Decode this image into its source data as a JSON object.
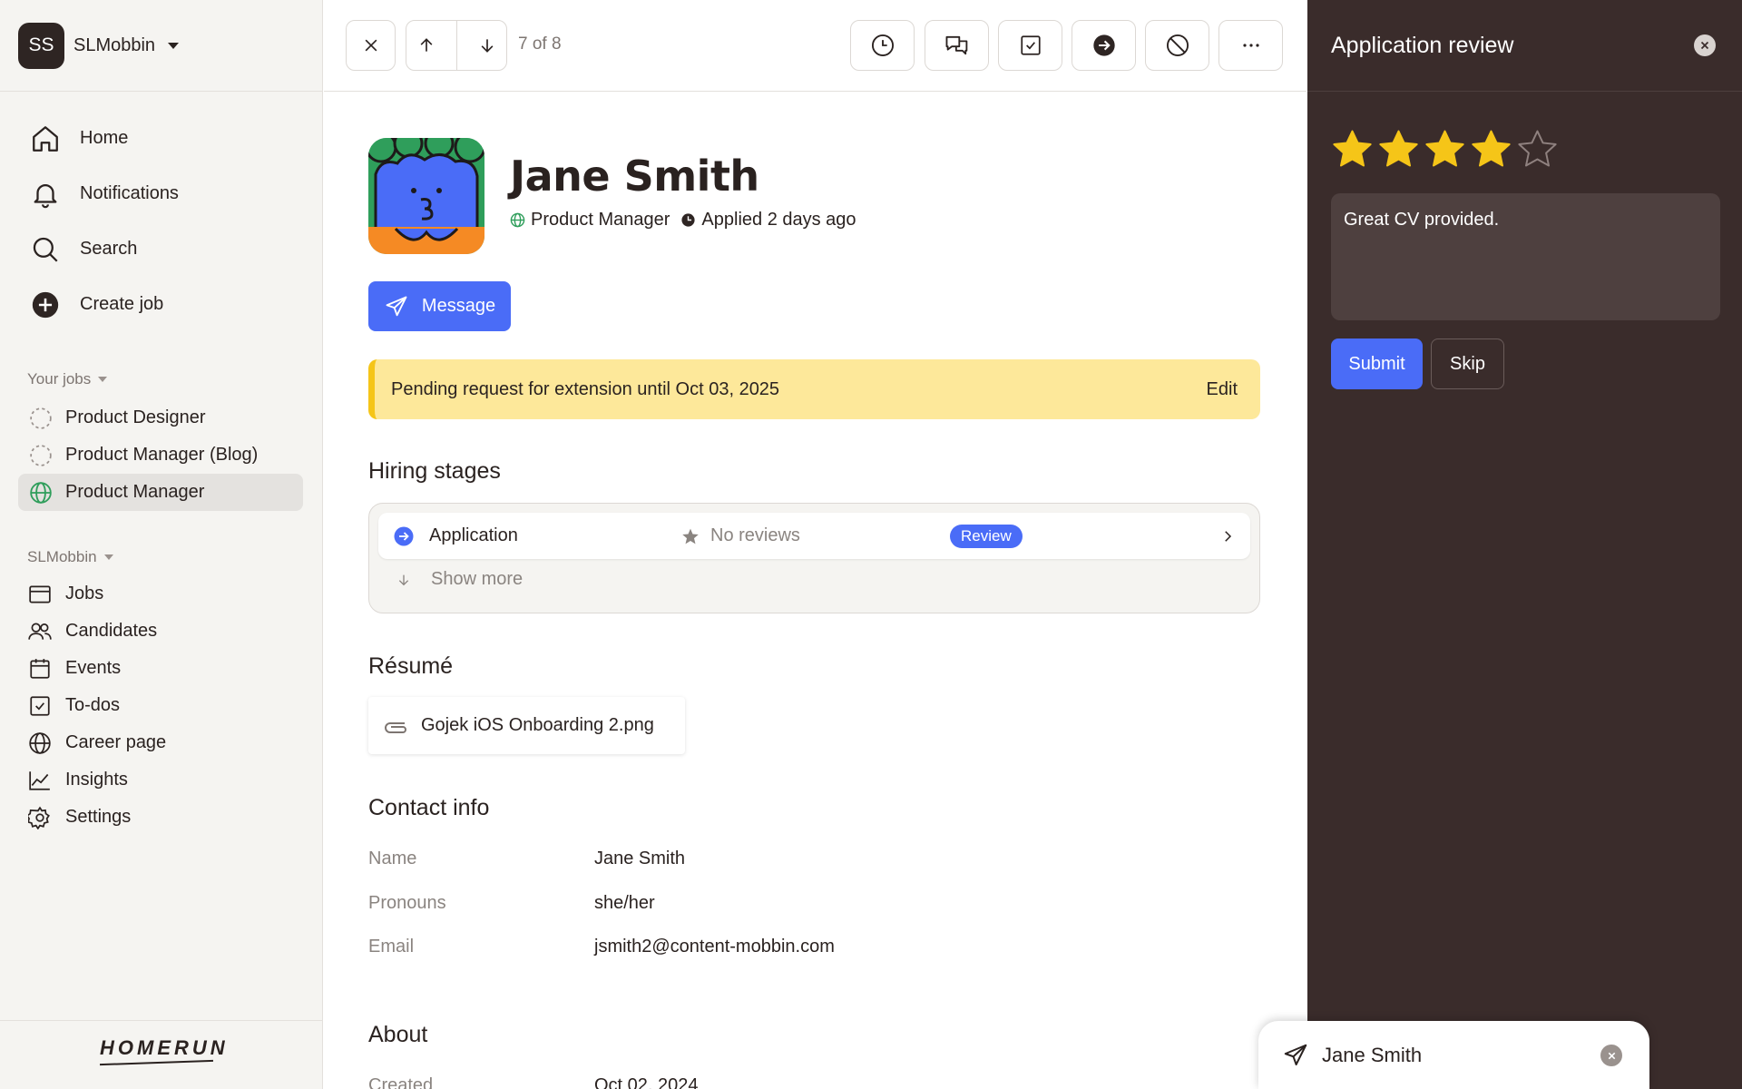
{
  "workspace": {
    "initials": "SS",
    "name": "SLMobbin"
  },
  "nav": [
    {
      "label": "Home",
      "icon": "home-icon"
    },
    {
      "label": "Notifications",
      "icon": "bell-icon"
    },
    {
      "label": "Search",
      "icon": "search-icon"
    },
    {
      "label": "Create job",
      "icon": "plus-circle-icon"
    }
  ],
  "your_jobs": {
    "heading": "Your jobs",
    "items": [
      {
        "label": "Product Designer",
        "icon": "draft-circle-icon"
      },
      {
        "label": "Product Manager (Blog)",
        "icon": "draft-circle-icon"
      },
      {
        "label": "Product Manager",
        "icon": "globe-icon",
        "active": true
      }
    ]
  },
  "org": {
    "heading": "SLMobbin",
    "items": [
      {
        "label": "Jobs",
        "icon": "window-icon"
      },
      {
        "label": "Candidates",
        "icon": "users-icon"
      },
      {
        "label": "Events",
        "icon": "calendar-icon"
      },
      {
        "label": "To-dos",
        "icon": "checkbox-icon"
      },
      {
        "label": "Career page",
        "icon": "globe-icon"
      },
      {
        "label": "Insights",
        "icon": "chart-icon"
      },
      {
        "label": "Settings",
        "icon": "gear-icon"
      }
    ]
  },
  "brand": {
    "logo_text": "HOMERUN"
  },
  "toolbar": {
    "counter": "7 of 8"
  },
  "candidate": {
    "name": "Jane Smith",
    "role": "Product Manager",
    "applied": "Applied 2 days ago",
    "message_label": "Message"
  },
  "banner": {
    "text": "Pending request for extension until Oct 03, 2025",
    "action": "Edit"
  },
  "hiring": {
    "title": "Hiring stages",
    "stage": "Application",
    "reviews": "No reviews",
    "badge": "Review",
    "show_more": "Show more"
  },
  "resume": {
    "title": "Résumé",
    "file": "Gojek iOS Onboarding 2.png"
  },
  "contact": {
    "title": "Contact info",
    "rows": [
      {
        "label": "Name",
        "value": "Jane Smith"
      },
      {
        "label": "Pronouns",
        "value": "she/her"
      },
      {
        "label": "Email",
        "value": "jsmith2@content-mobbin.com"
      }
    ]
  },
  "about": {
    "title": "About",
    "rows": [
      {
        "label": "Created",
        "value": "Oct 02, 2024"
      }
    ]
  },
  "review_panel": {
    "title": "Application review",
    "rating": 4,
    "rating_max": 5,
    "note": "Great CV provided.",
    "submit": "Submit",
    "skip": "Skip"
  },
  "draft": {
    "recipient": "Jane Smith"
  },
  "colors": {
    "accent": "#4a6cf7",
    "star": "#f5c518",
    "panel_bg": "#3a2c2b",
    "banner_bg": "#fde89a",
    "active_job": "#2f9e5b"
  }
}
